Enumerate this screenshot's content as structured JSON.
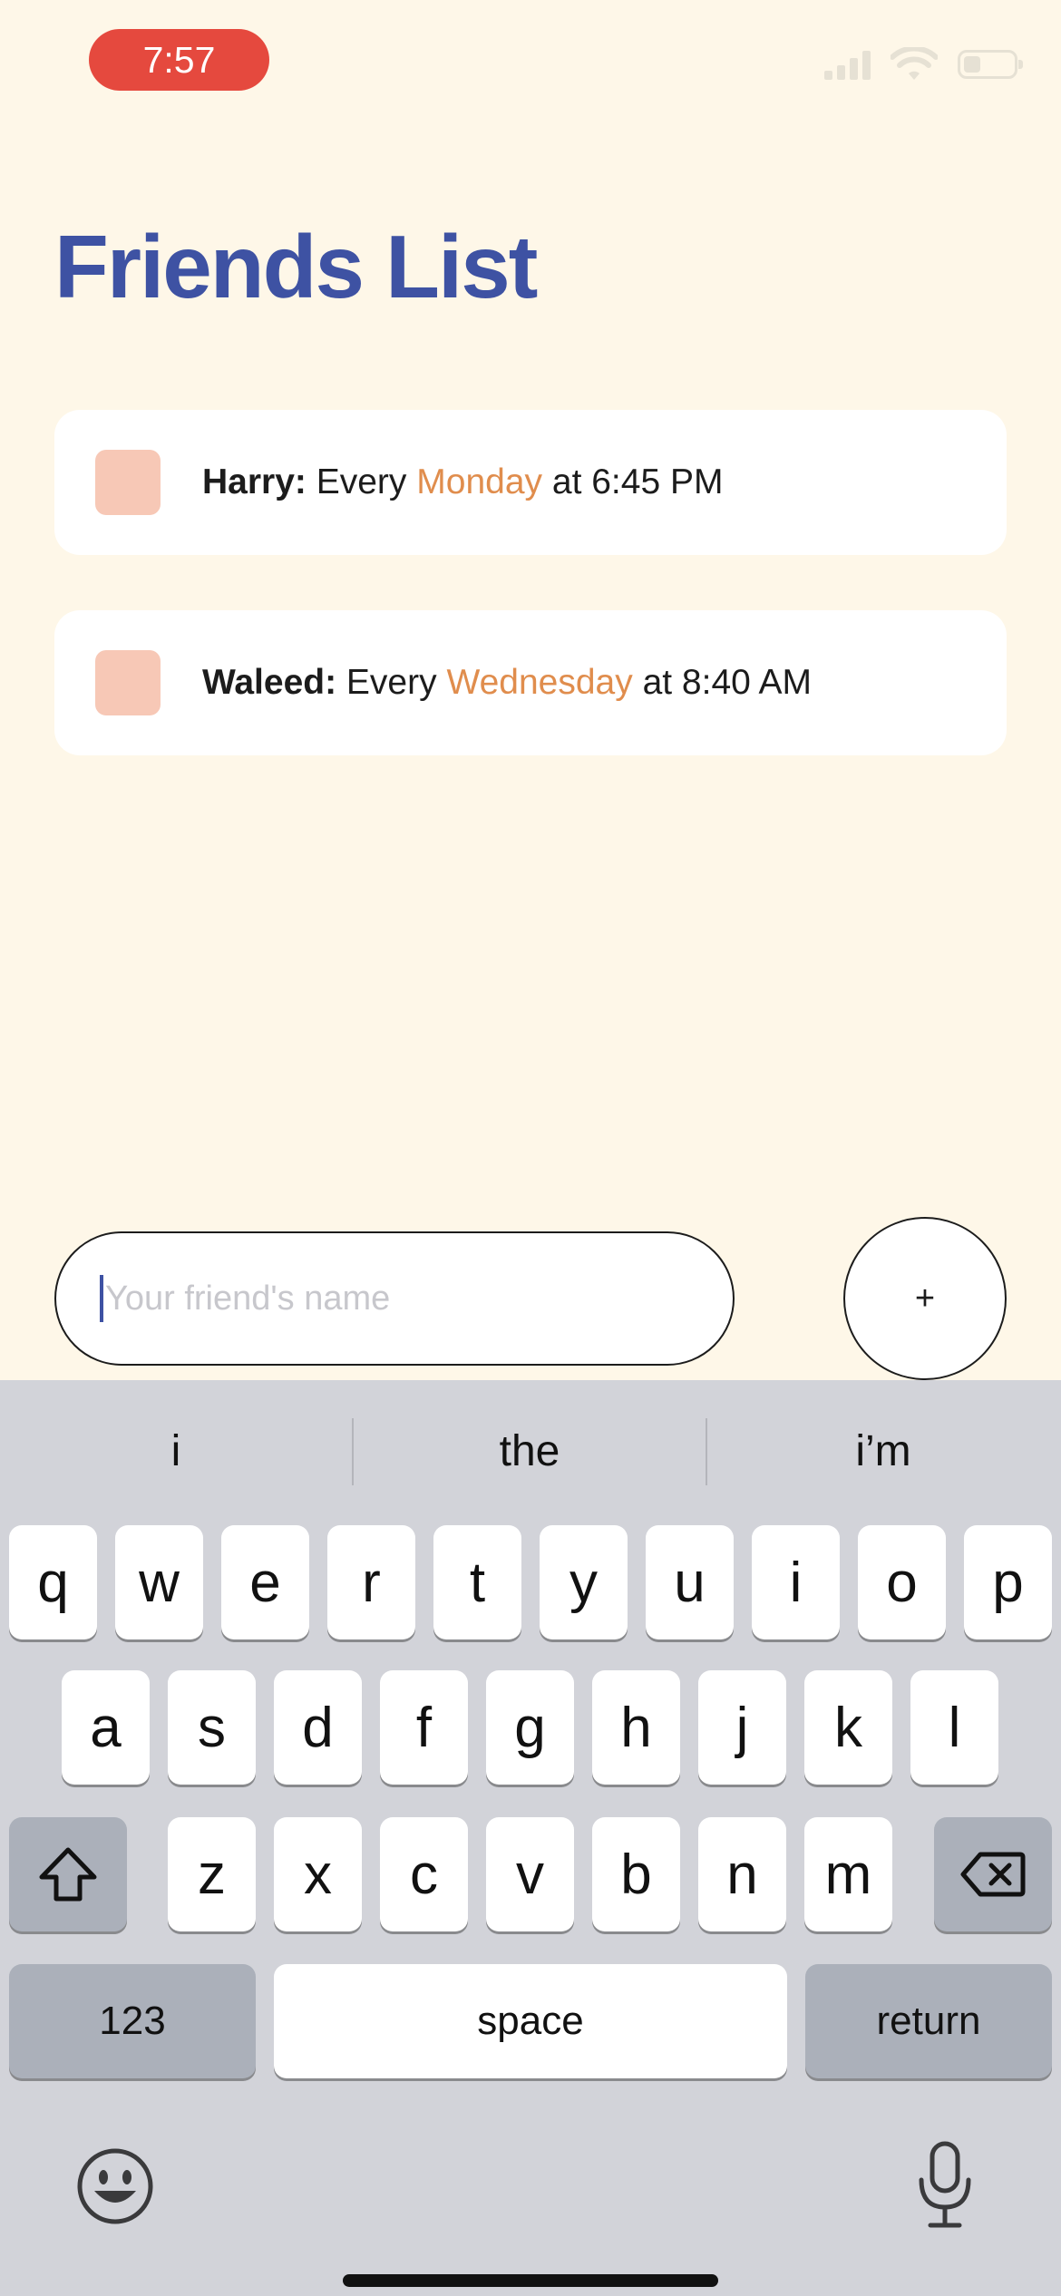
{
  "status_bar": {
    "time": "7:57"
  },
  "page": {
    "title": "Friends List"
  },
  "friends": [
    {
      "name": "Harry:",
      "prefix": "Every",
      "day": "Monday",
      "suffix": "at 6:45 PM",
      "checked": false
    },
    {
      "name": "Waleed:",
      "prefix": "Every",
      "day": "Wednesday",
      "suffix": "at 8:40 AM",
      "checked": false
    }
  ],
  "input": {
    "placeholder": "Your friend's name",
    "value": ""
  },
  "add_button": {
    "label": "+"
  },
  "keyboard": {
    "suggestions": [
      "i",
      "the",
      "i’m"
    ],
    "rows": [
      [
        "q",
        "w",
        "e",
        "r",
        "t",
        "y",
        "u",
        "i",
        "o",
        "p"
      ],
      [
        "a",
        "s",
        "d",
        "f",
        "g",
        "h",
        "j",
        "k",
        "l"
      ],
      [
        "z",
        "x",
        "c",
        "v",
        "b",
        "n",
        "m"
      ]
    ],
    "numbers_label": "123",
    "space_label": "space",
    "return_label": "return"
  },
  "colors": {
    "background": "#FEF7E8",
    "title": "#3E52A3",
    "accent_day": "#E08D4D",
    "checkbox": "#F7C8B6",
    "time_pill": "#E5493E"
  }
}
